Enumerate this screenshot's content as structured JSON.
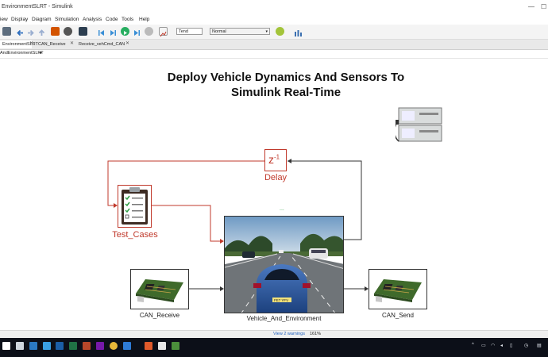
{
  "window": {
    "title": "EnvironmentSLRT - Simulink",
    "minimize": "—",
    "maximize": "☐"
  },
  "menu": [
    "iew",
    "Display",
    "Diagram",
    "Simulation",
    "Analysis",
    "Code",
    "Tools",
    "Help"
  ],
  "toolbar": {
    "stop_time": "Tend",
    "sim_mode": "Normal"
  },
  "tabs": [
    {
      "label": "EnvironmentSLRT"
    },
    {
      "label": "CAN_Receive"
    },
    {
      "label": "Receive_vehCmd_CAN"
    }
  ],
  "breadcrumb": "AndEnvironmentSLRT",
  "diagram": {
    "title_line1": "Deploy Vehicle Dynamics And Sensors To",
    "title_line2": "Simulink Real-Time",
    "delay_block": {
      "symbol": "z",
      "exponent": "-1",
      "label": "Delay"
    },
    "test_cases_label": "Test_Cases",
    "vehicle_label": "Vehicle_And_Environment",
    "vehicle_dots": "...",
    "car_plate": "FE7 YFV",
    "can_receive_label": "CAN_Receive",
    "can_send_label": "CAN_Send"
  },
  "statusbar": {
    "warnings": "View 2 warnings",
    "zoom": "161%"
  },
  "colors": {
    "signal_red": "#c0392b",
    "toolbar_bg": "#f4f4f4",
    "taskbar_bg": "#0c0f18"
  }
}
